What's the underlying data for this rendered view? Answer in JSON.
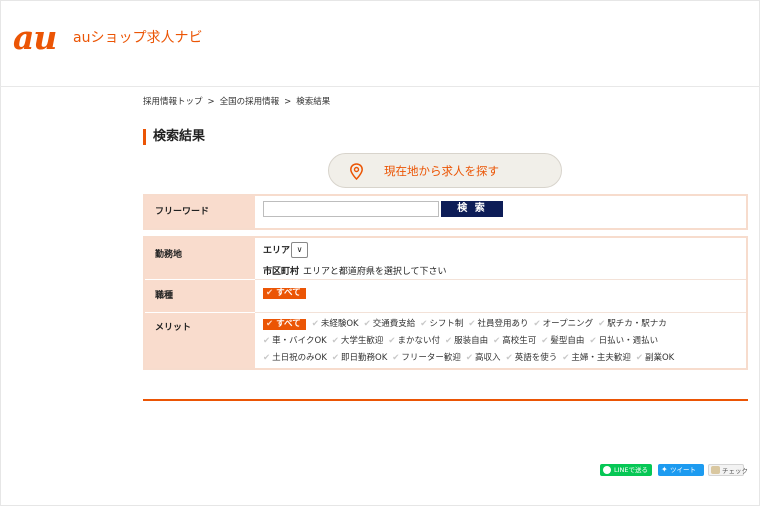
{
  "header": {
    "logo_mark": "au",
    "logo_text": "auショップ求人ナビ"
  },
  "breadcrumb": [
    {
      "label": "採用情報トップ"
    },
    {
      "label": "全国の採用情報"
    },
    {
      "label": "検索結果"
    }
  ],
  "breadcrumb_separator": ">",
  "page_title": "検索結果",
  "location_button": {
    "label": "現在地から求人を探す",
    "icon": "map-pin-icon"
  },
  "freeword": {
    "label": "フリーワード",
    "value": "",
    "search_label": "検 索"
  },
  "filters": {
    "work_location_label": "勤務地",
    "area_label": "エリア",
    "city_label": "市区町村",
    "city_hint": "エリアと都道府県を選択して下さい",
    "job_type_label": "職種",
    "all_label": "すべて",
    "merit_label": "メリット",
    "merit_lines": [
      [
        "未経験OK",
        "交通費支給",
        "シフト制",
        "社員登用あり",
        "オープニング",
        "駅チカ・駅ナカ"
      ],
      [
        "車・バイクOK",
        "大学生歓迎",
        "まかない付",
        "服装自由",
        "高校生可",
        "髪型自由",
        "日払い・週払い"
      ],
      [
        "土日祝のみOK",
        "即日勤務OK",
        "フリーター歓迎",
        "高収入",
        "英語を使う",
        "主婦・主夫歓迎",
        "副業OK"
      ]
    ]
  },
  "share": {
    "line": "LINEで送る",
    "tweet": "ツイート",
    "hatena": "チェック"
  },
  "colors": {
    "accent": "#eb5505",
    "header_cell": "#f9dccd",
    "search_button": "#0d1d57"
  }
}
